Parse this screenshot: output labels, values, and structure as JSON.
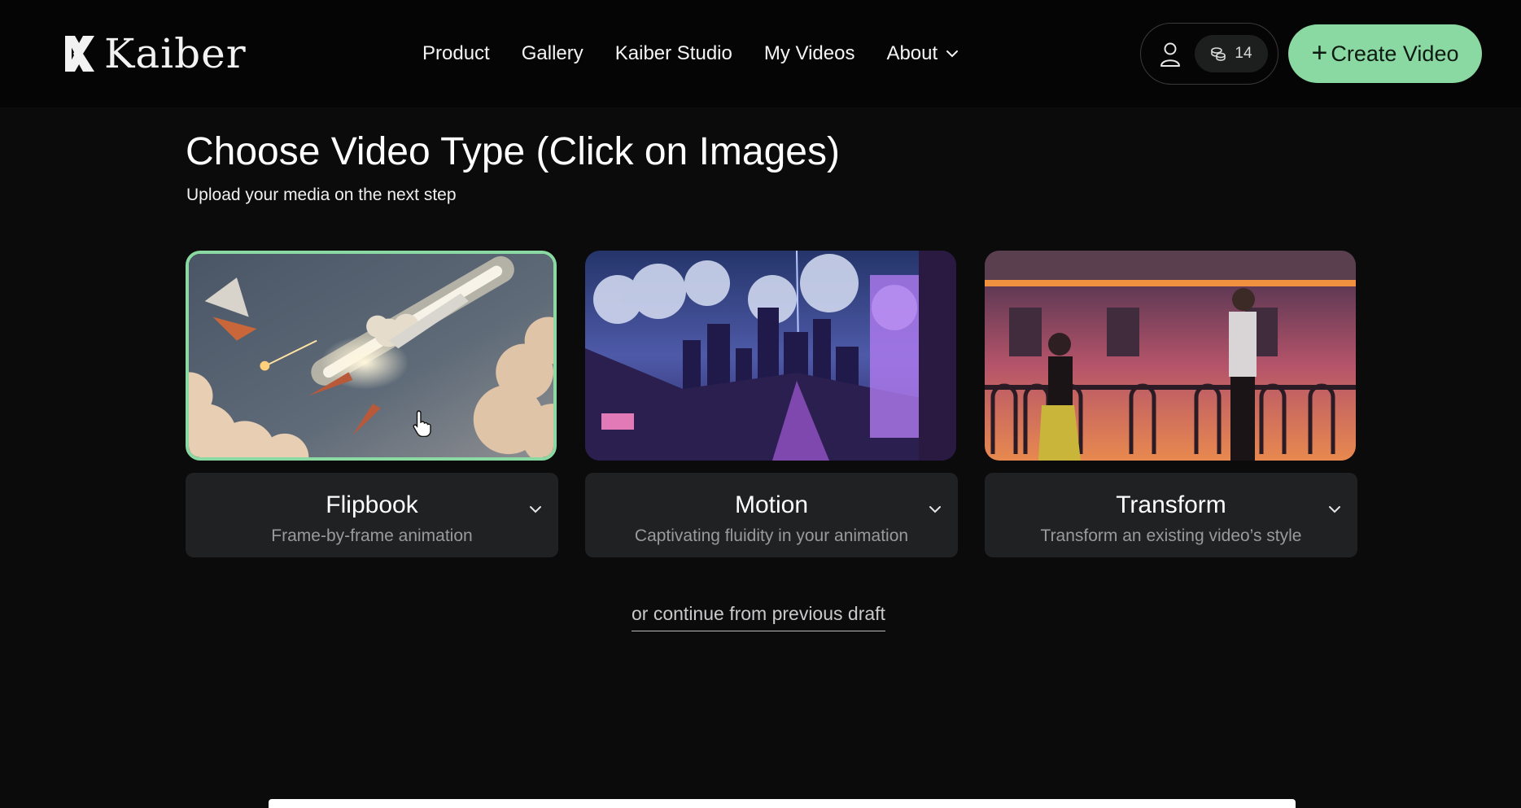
{
  "brand": {
    "name": "Kaiber",
    "logo_icon": "kaiber-logo-icon"
  },
  "nav": {
    "items": [
      "Product",
      "Gallery",
      "Kaiber Studio",
      "My Videos",
      "About"
    ]
  },
  "account": {
    "user_icon": "user-icon",
    "credits_icon": "coins-icon",
    "credits": "14"
  },
  "create_button": {
    "plus": "+",
    "label": "Create Video"
  },
  "page": {
    "title": "Choose Video Type (Click on Images)",
    "subtitle": "Upload your media on the next step"
  },
  "cards": [
    {
      "title": "Flipbook",
      "description": "Frame-by-frame animation",
      "selected": true
    },
    {
      "title": "Motion",
      "description": "Captivating fluidity in your animation",
      "selected": false
    },
    {
      "title": "Transform",
      "description": "Transform an existing video’s style",
      "selected": false
    }
  ],
  "draft_link": "or continue from previous draft",
  "colors": {
    "accent": "#8ad9a2",
    "background": "#0b0b0c",
    "card": "#202123"
  }
}
